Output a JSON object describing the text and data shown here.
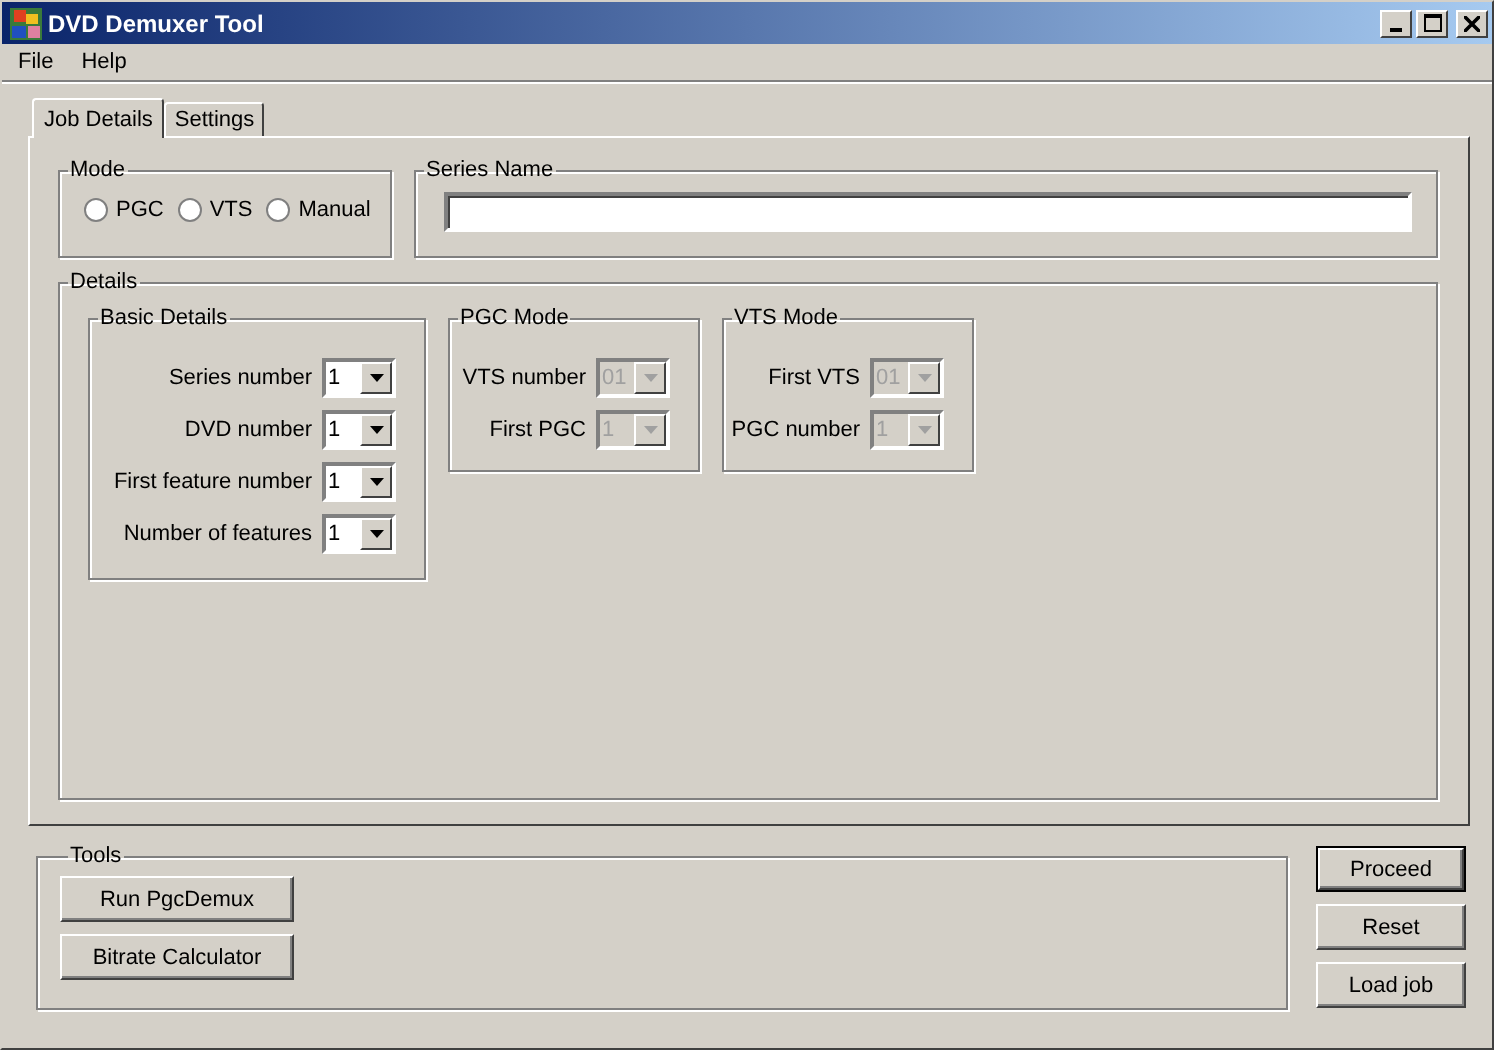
{
  "window": {
    "title": "DVD Demuxer Tool"
  },
  "menu": [
    "File",
    "Help"
  ],
  "tabs": [
    {
      "label": "Job Details",
      "selected": true
    },
    {
      "label": "Settings",
      "selected": false
    }
  ],
  "mode": {
    "title": "Mode",
    "options": [
      {
        "label": "PGC",
        "selected": false
      },
      {
        "label": "VTS",
        "selected": false
      },
      {
        "label": "Manual",
        "selected": false
      }
    ]
  },
  "series_name": {
    "title": "Series Name"
  },
  "details": {
    "title": "Details",
    "groups": [
      {
        "title": "Basic Details",
        "fields": [
          {
            "label": "Series number",
            "value": "1",
            "disabled": false
          },
          {
            "label": "DVD number",
            "value": "1",
            "disabled": false
          },
          {
            "label": "First feature number",
            "value": "1",
            "disabled": false
          },
          {
            "label": "Number of features",
            "value": "1",
            "disabled": false
          }
        ]
      },
      {
        "title": "PGC Mode",
        "fields": [
          {
            "label": "VTS number",
            "value": "01",
            "disabled": true
          },
          {
            "label": "First PGC",
            "value": "1",
            "disabled": true
          }
        ]
      },
      {
        "title": "VTS Mode",
        "fields": [
          {
            "label": "First VTS",
            "value": "01",
            "disabled": true
          },
          {
            "label": "PGC number",
            "value": "1",
            "disabled": true
          }
        ]
      }
    ]
  },
  "tools": {
    "title": "Tools",
    "buttons": [
      "Run PgcDemux",
      "Bitrate Calculator"
    ]
  },
  "actions": [
    {
      "label": "Proceed",
      "default": true
    },
    {
      "label": "Reset",
      "default": false
    },
    {
      "label": "Load job",
      "default": false
    }
  ]
}
